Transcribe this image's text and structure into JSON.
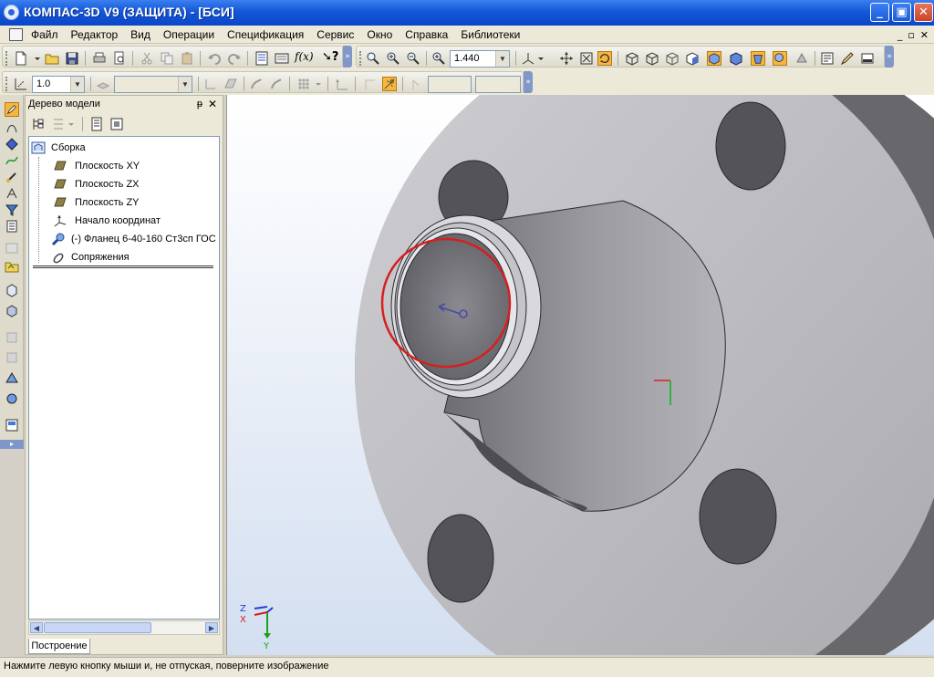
{
  "window": {
    "title": "КОМПАС-3D V9 (ЗАЩИТА) - [БСИ]",
    "minimize_glyph": "_",
    "maximize_glyph": "▣",
    "close_glyph": "✕"
  },
  "menu": {
    "items": [
      "Файл",
      "Редактор",
      "Вид",
      "Операции",
      "Спецификация",
      "Сервис",
      "Окно",
      "Справка",
      "Библиотеки"
    ],
    "mdi_minimize": "_",
    "mdi_restore": "▫",
    "mdi_close": "✕"
  },
  "toolbar": {
    "zoom_value": "1.440",
    "step_value": "1.0",
    "fx_label": "f(x)",
    "help_glyph": "?"
  },
  "tree_panel": {
    "title": "Дерево модели",
    "pin_glyph": "ᵽ",
    "close_glyph": "✕",
    "items": [
      {
        "label": "Сборка",
        "icon": "assembly-icon"
      },
      {
        "label": "Плоскость XY",
        "icon": "plane-icon"
      },
      {
        "label": "Плоскость ZX",
        "icon": "plane-icon"
      },
      {
        "label": "Плоскость ZY",
        "icon": "plane-icon"
      },
      {
        "label": "Начало координат",
        "icon": "origin-icon"
      },
      {
        "label": "(-) Фланец 6-40-160 Ст3сп ГОС",
        "icon": "part-icon"
      },
      {
        "label": "Сопряжения",
        "icon": "mate-icon"
      }
    ],
    "tab_label": "Построение"
  },
  "axis_triad": {
    "z": "Z",
    "x": "X",
    "y": "Y"
  },
  "status": {
    "text": "Нажмите левую кнопку мыши и, не отпуская, поверните изображение"
  },
  "colors": {
    "title_bar": "#1457d8",
    "highlight_circle": "#d62020",
    "part_face": "#b9b9bd",
    "part_shadow": "#6c6c70"
  }
}
